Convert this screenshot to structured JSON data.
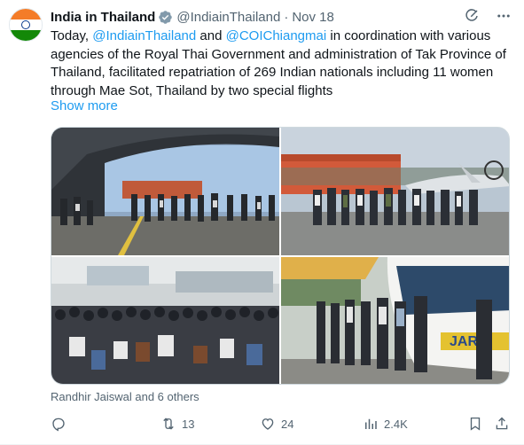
{
  "author": {
    "name": "India in Thailand",
    "handle": "@IndiainThailand",
    "separator": "·",
    "date": "Nov 18"
  },
  "tweet": {
    "text_segments": {
      "t1": "Today, ",
      "m1": "@IndiainThailand",
      "t2": " and ",
      "m2": "@COIChiangmai",
      "t3": " in coordination with various agencies of the Royal Thai Government and  administration of Tak Province of Thailand, facilitated repatriation of 269 Indian nationals including 11 women through Mae Sot, Thailand by two special flights"
    },
    "show_more": "Show more"
  },
  "likes_line": "Randhir Jaiswal and 6 others",
  "actions": {
    "reply_count": "",
    "retweet_count": "13",
    "like_count": "24",
    "views_count": "2.4K"
  },
  "icons": {
    "verified": "verified-badge-icon",
    "grok": "grok-icon",
    "more": "more-icon",
    "reply": "reply-icon",
    "retweet": "retweet-icon",
    "like": "heart-icon",
    "views": "views-icon",
    "bookmark": "bookmark-icon",
    "share": "share-icon"
  },
  "colors": {
    "accent": "#1d9bf0",
    "secondary_text": "#536471",
    "primary_text": "#0f1419"
  }
}
